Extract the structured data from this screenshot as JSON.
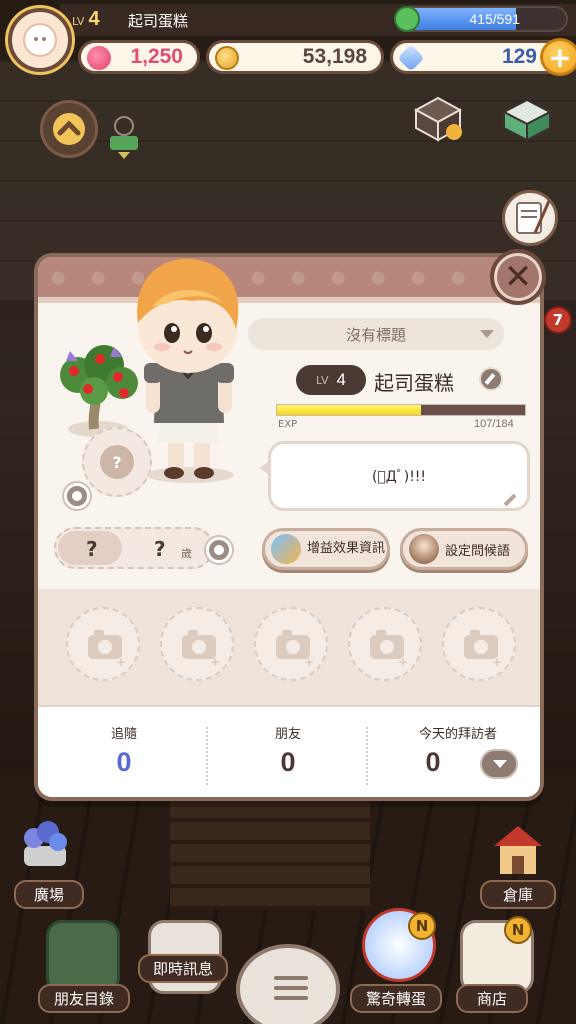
{
  "hud": {
    "level_label": "LV",
    "level": "4",
    "player_name": "起司蛋糕",
    "energy_text": "415/591",
    "energy_fraction": 0.702,
    "hearts": "1,250",
    "coins": "53,198",
    "gems": "129",
    "plus_label": "+"
  },
  "profile": {
    "close_label": "✕",
    "title_select": "沒有標題",
    "level_label": "LV",
    "level": "4",
    "name": "起司蛋糕",
    "exp_label": "EXP",
    "exp_text": "107/184",
    "exp_fraction": 0.58,
    "message": "(ﾟДﾟ)!!!",
    "mystery_slot": "?",
    "age_icon_label": "?",
    "age_value": "?",
    "age_unit": "歲",
    "buff_button": "增益效果資訊",
    "greeting_button": "設定問候語"
  },
  "stats": {
    "follow_label": "追隨",
    "follow_value": "0",
    "friends_label": "朋友",
    "friends_value": "0",
    "visitors_label": "今天的拜訪者",
    "visitors_value": "0"
  },
  "menu": {
    "plaza": "廣場",
    "warehouse": "倉庫",
    "friend_list": "朋友目錄",
    "instant_messages": "即時訊息",
    "gacha": "驚奇轉蛋",
    "shop": "商店",
    "gacha_badge": "N",
    "shop_badge": "N",
    "mail_badge": "7"
  },
  "colors": {
    "accent_brown": "#8a6a58",
    "heart": "#e04f73",
    "gem": "#3a5ea8",
    "follow_value": "#5b6ad0",
    "exp_fill": "#f3d61f"
  }
}
